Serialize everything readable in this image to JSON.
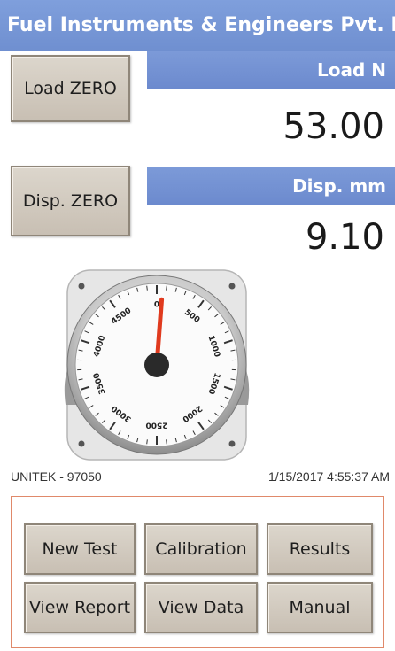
{
  "header": {
    "title": "Fuel Instruments & Engineers Pvt. Ltd."
  },
  "load": {
    "zero_button": "Load ZERO",
    "label": "Load N",
    "value": "53.00"
  },
  "displacement": {
    "zero_button": "Disp. ZERO",
    "label": "Disp. mm",
    "value": "9.10"
  },
  "gauge": {
    "scale_labels": [
      "0",
      "500",
      "1000",
      "1500",
      "2000",
      "2500",
      "3000",
      "3500",
      "4000",
      "4500"
    ],
    "needle_value": 60,
    "scale_max": 5000,
    "needle_color": "#e03a1e"
  },
  "status": {
    "device_id": "UNITEK - 97050",
    "datetime": "1/15/2017 4:55:37 AM"
  },
  "menu": {
    "new_test": "New Test",
    "calibration": "Calibration",
    "results": "Results",
    "view_report": "View Report",
    "view_data": "View Data",
    "manual": "Manual"
  },
  "colors": {
    "header_blue": "#7393d4",
    "button_beige": "#d2cbc0",
    "panel_border": "#e0896a"
  }
}
